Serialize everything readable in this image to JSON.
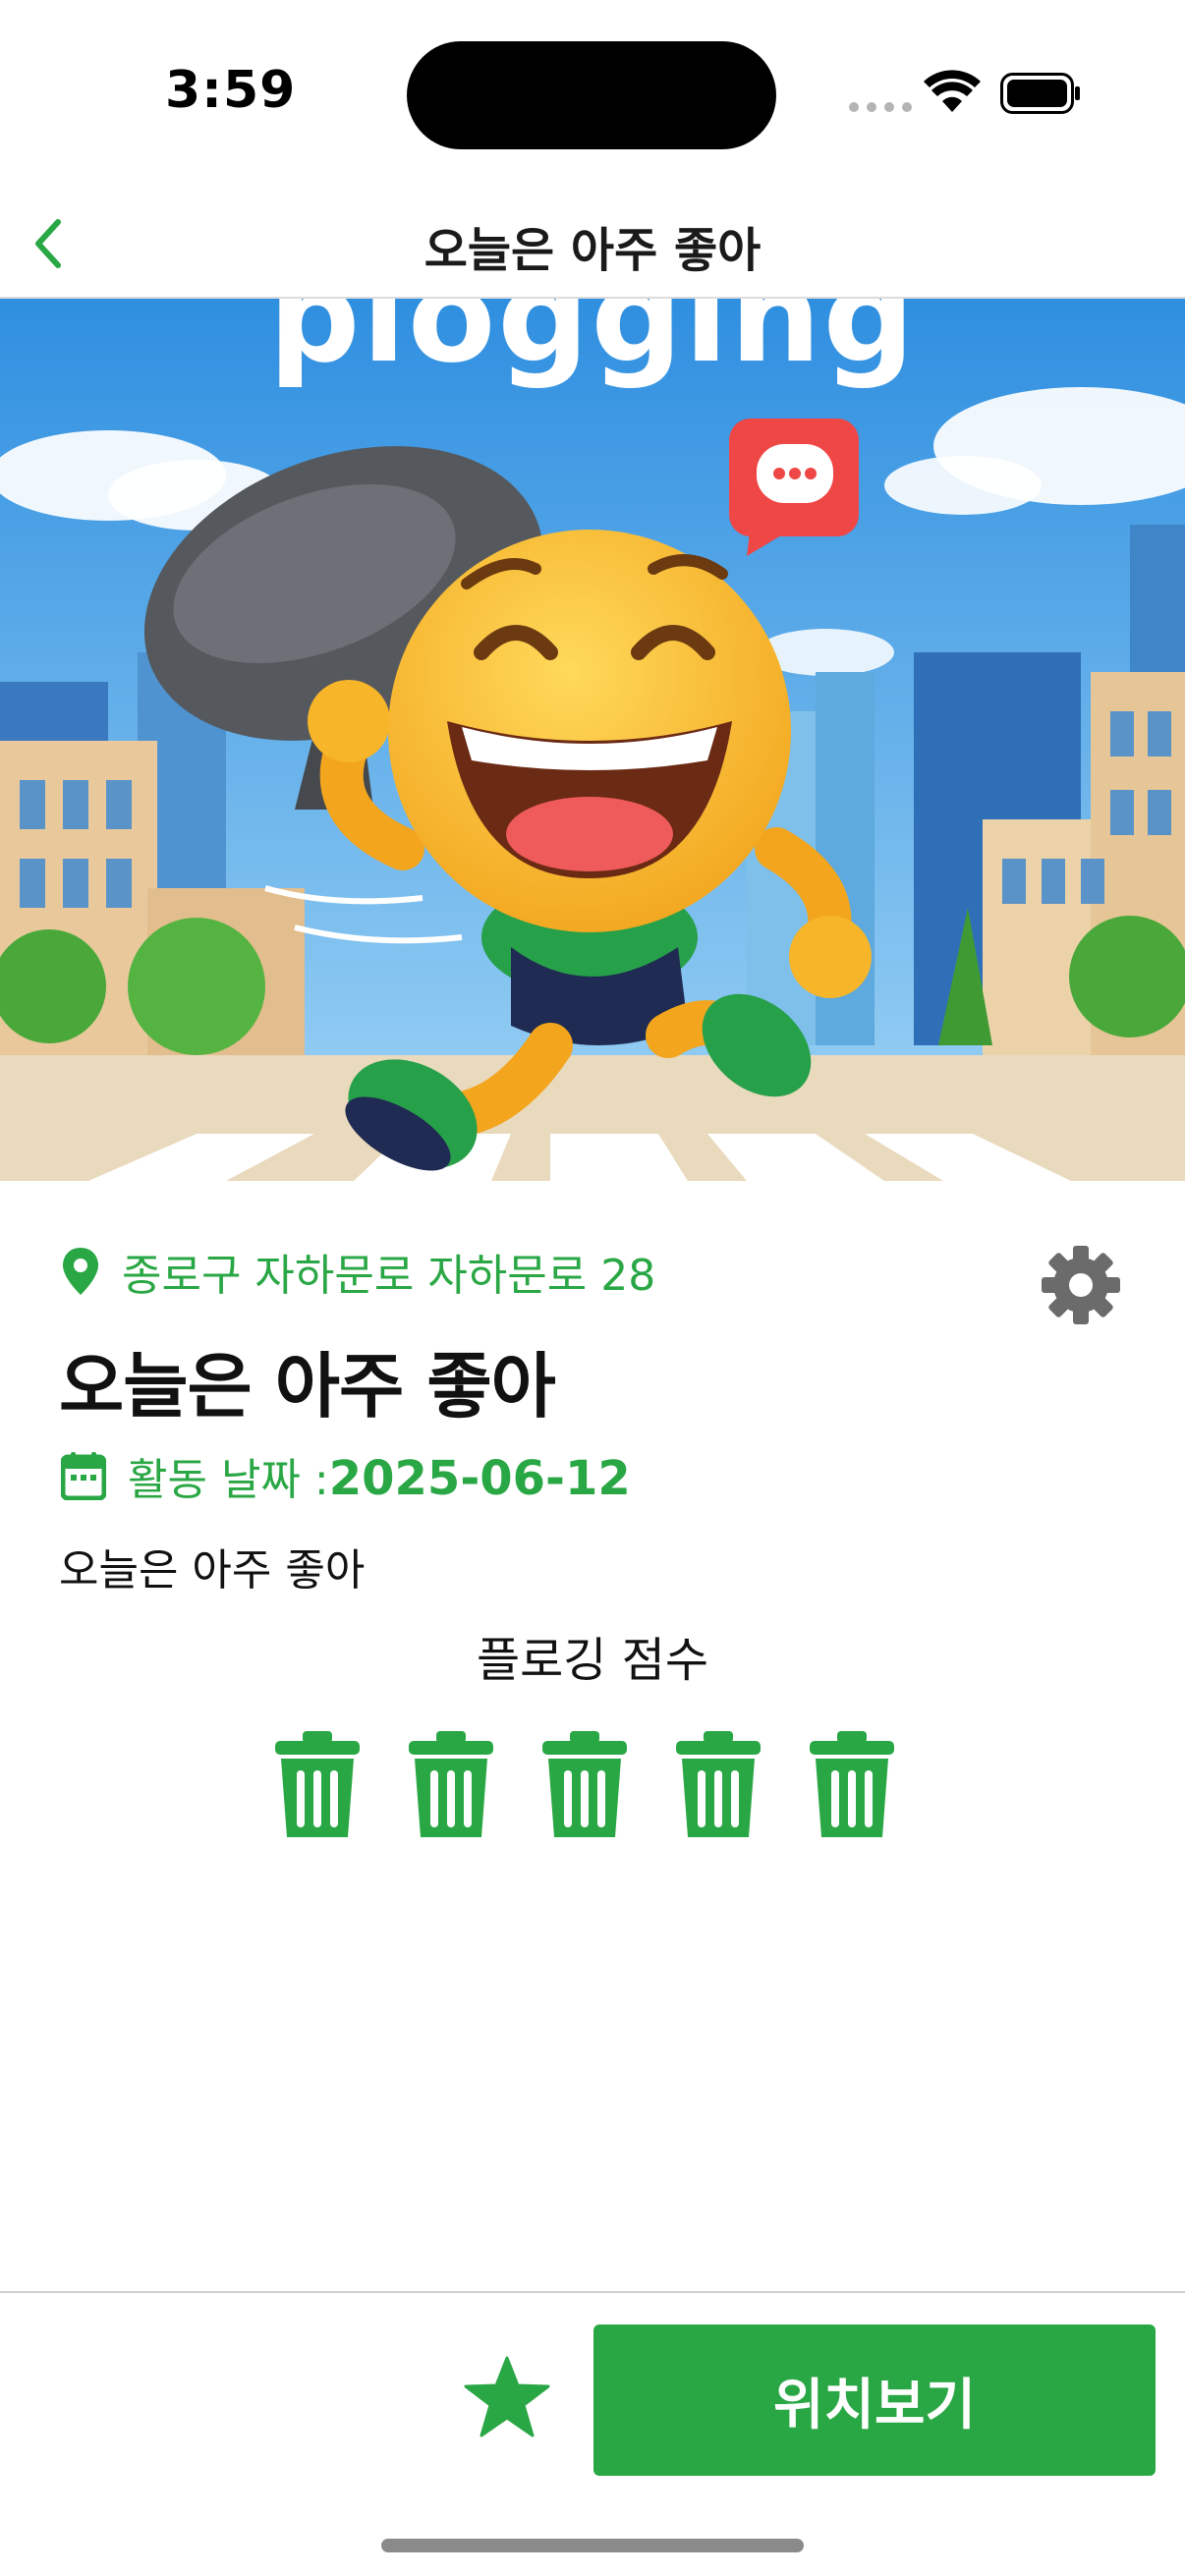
{
  "status_bar": {
    "time": "3:59"
  },
  "nav": {
    "title": "오늘은 아주 좋아",
    "back_icon": "chevron-left-icon"
  },
  "hero": {
    "word": "plogging",
    "image_icon": "plogging-mascot-illustration"
  },
  "post": {
    "location": "종로구 자하문로 자하문로 28",
    "title": "오늘은 아주 좋아",
    "date_label": "활동 날짜 :",
    "date_value": "2025-06-12",
    "body": "오늘은 아주 좋아"
  },
  "score": {
    "title": "플로깅 점수",
    "value": 5,
    "max": 5,
    "icon": "trash-can-icon"
  },
  "actions": {
    "favorite_icon": "star-icon",
    "location_button_label": "위치보기"
  },
  "colors": {
    "accent": "#2aa745",
    "settings_icon": "#6b6b6b"
  }
}
